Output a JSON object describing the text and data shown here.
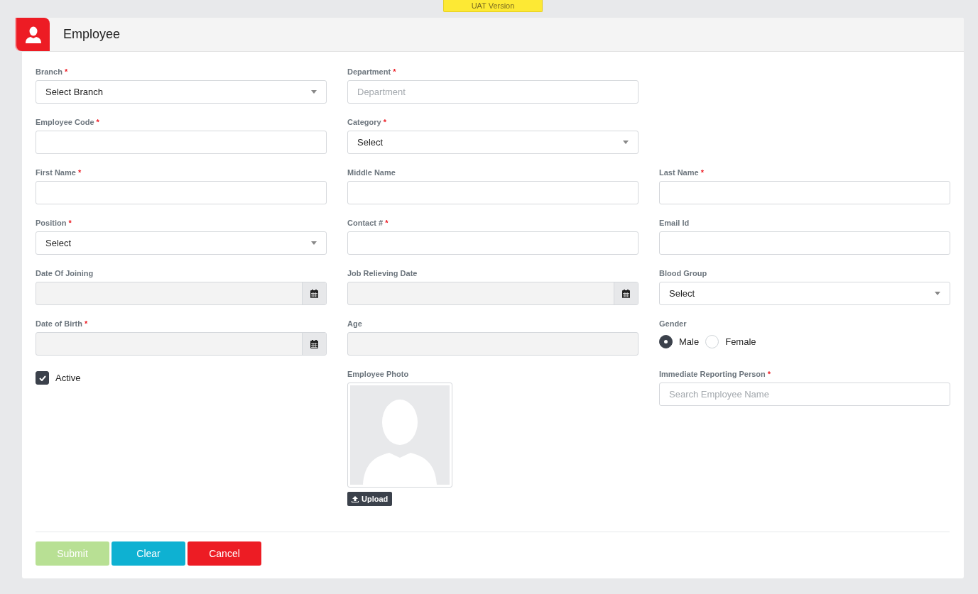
{
  "badge": "UAT Version",
  "header": {
    "title": "Employee"
  },
  "rows": [
    {
      "fields": [
        {
          "kind": "select",
          "label": "Branch",
          "mark": "*",
          "value": "Select Branch"
        },
        {
          "kind": "text",
          "label": "Department",
          "mark": "*",
          "placeholder": "Department"
        }
      ]
    },
    {
      "fields": [
        {
          "kind": "text",
          "label": "Employee Code",
          "mark": "*"
        },
        {
          "kind": "select",
          "label": "Category",
          "mark": "*",
          "value": "Select"
        }
      ]
    },
    {
      "fields": [
        {
          "kind": "text",
          "label": "First Name",
          "mark": "*"
        },
        {
          "kind": "text",
          "label": "Middle Name"
        },
        {
          "kind": "text",
          "label": "Last Name",
          "mark": "*"
        }
      ]
    },
    {
      "fields": [
        {
          "kind": "select",
          "label": "Position",
          "mark": "*",
          "value": "Select"
        },
        {
          "kind": "text",
          "label": "Contact #",
          "mark": "*"
        },
        {
          "kind": "text",
          "label": "Email Id"
        }
      ]
    },
    {
      "fields": [
        {
          "kind": "date",
          "label": "Date Of Joining"
        },
        {
          "kind": "date",
          "label": "Job Relieving Date"
        },
        {
          "kind": "select",
          "label": "Blood Group",
          "value": "Select"
        }
      ]
    },
    {
      "fields": [
        {
          "kind": "date",
          "label": "Date of Birth",
          "mark": "*"
        },
        {
          "kind": "readonly",
          "label": "Age"
        },
        {
          "kind": "radio",
          "label": "Gender",
          "options": [
            {
              "label": "Male",
              "selected": true
            },
            {
              "label": "Female",
              "selected": false
            }
          ]
        }
      ]
    },
    {
      "fields": [
        {
          "kind": "checkbox",
          "label": "Active",
          "checked": true
        },
        {
          "kind": "photo",
          "label": "Employee Photo",
          "button": "Upload"
        },
        {
          "kind": "text",
          "label": "Immediate Reporting Person",
          "mark": "*",
          "placeholder": "Search Employee Name"
        }
      ]
    }
  ],
  "buttons": [
    {
      "label": "Submit",
      "kind": "success",
      "disabled": true
    },
    {
      "label": "Clear",
      "kind": "info",
      "disabled": false
    },
    {
      "label": "Cancel",
      "kind": "danger",
      "disabled": false
    }
  ]
}
